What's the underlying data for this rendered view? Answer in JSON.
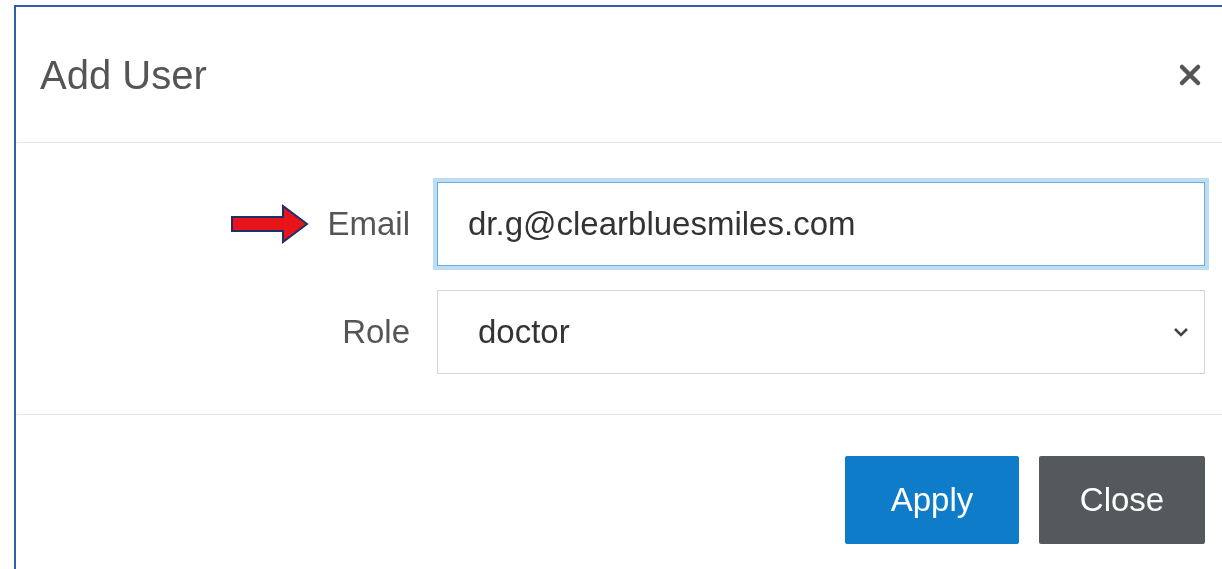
{
  "dialog": {
    "title": "Add User",
    "fields": [
      {
        "kind": "text",
        "label": "Email",
        "value": "dr.g@clearbluesmiles.com",
        "focused": true,
        "annotated": true
      },
      {
        "kind": "select",
        "label": "Role",
        "value": "doctor",
        "focused": false,
        "annotated": false
      }
    ],
    "buttons": [
      {
        "label": "Apply",
        "kind": "primary"
      },
      {
        "label": "Close",
        "kind": "secondary"
      }
    ]
  }
}
